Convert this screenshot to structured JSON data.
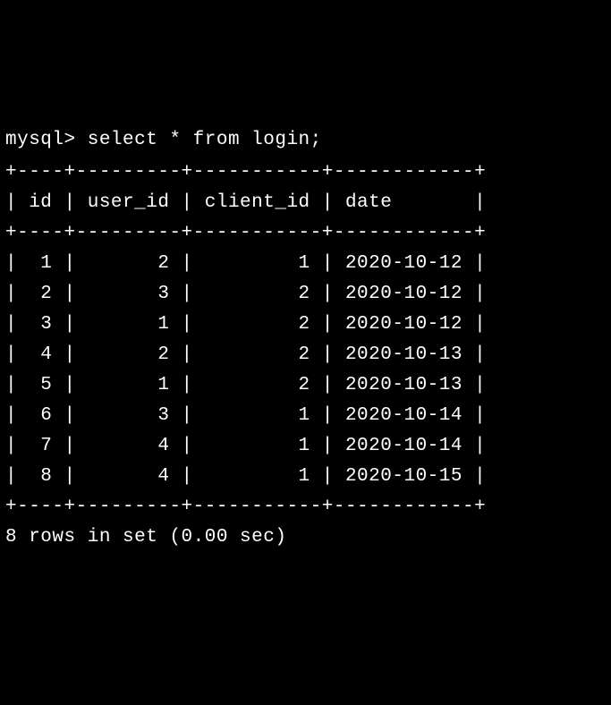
{
  "chart_data": {
    "type": "table",
    "title": "login",
    "columns": [
      "id",
      "user_id",
      "client_id",
      "date"
    ],
    "rows": [
      [
        1,
        2,
        1,
        "2020-10-12"
      ],
      [
        2,
        3,
        2,
        "2020-10-12"
      ],
      [
        3,
        1,
        2,
        "2020-10-12"
      ],
      [
        4,
        2,
        2,
        "2020-10-13"
      ],
      [
        5,
        1,
        2,
        "2020-10-13"
      ],
      [
        6,
        3,
        1,
        "2020-10-14"
      ],
      [
        7,
        4,
        1,
        "2020-10-14"
      ],
      [
        8,
        4,
        1,
        "2020-10-15"
      ]
    ]
  },
  "prompt": "mysql> ",
  "query": "select * from login;",
  "border": "+----+---------+-----------+------------+",
  "header_row": "| id | user_id | client_id | date       |",
  "data_rows": [
    "|  1 |       2 |         1 | 2020-10-12 |",
    "|  2 |       3 |         2 | 2020-10-12 |",
    "|  3 |       1 |         2 | 2020-10-12 |",
    "|  4 |       2 |         2 | 2020-10-13 |",
    "|  5 |       1 |         2 | 2020-10-13 |",
    "|  6 |       3 |         1 | 2020-10-14 |",
    "|  7 |       4 |         1 | 2020-10-14 |",
    "|  8 |       4 |         1 | 2020-10-15 |"
  ],
  "result_status": "8 rows in set (0.00 sec)"
}
